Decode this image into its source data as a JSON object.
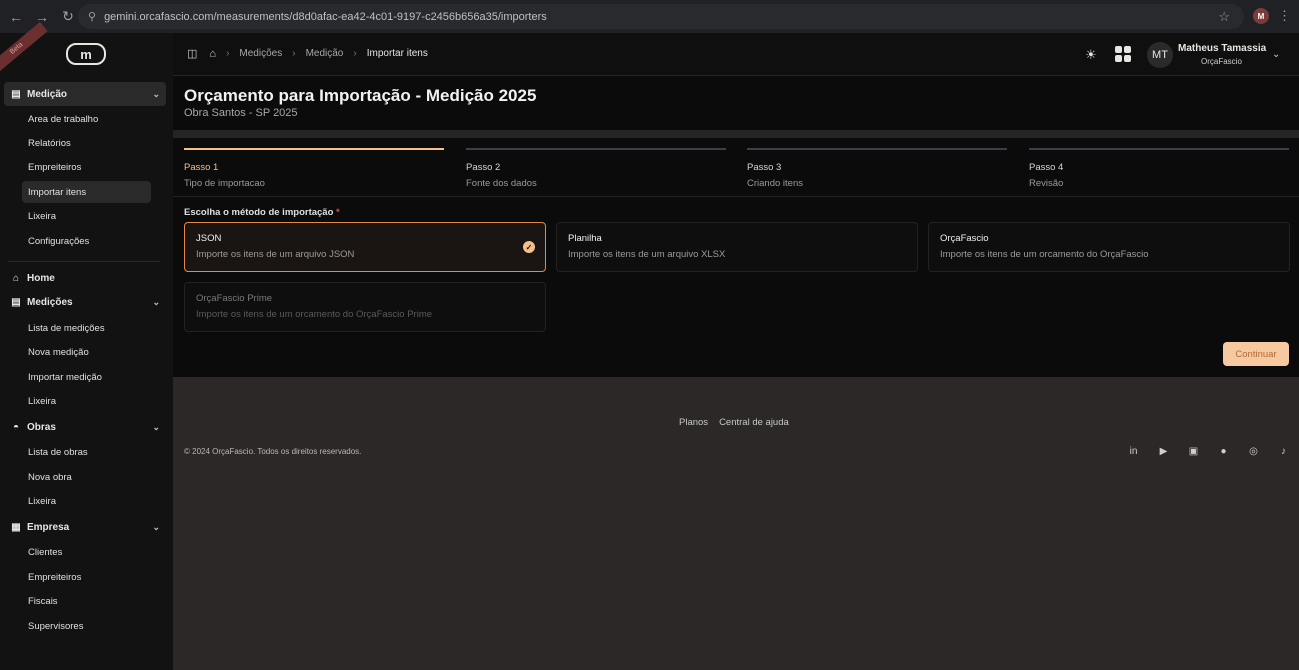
{
  "browser": {
    "url": "gemini.orcafascio.com/measurements/d8d0afac-ea42-4c01-9197-c2456b656a35/importers",
    "profile_initial": "M"
  },
  "sidebar": {
    "beta_label": "Beta",
    "logo_text": "m",
    "groups": [
      {
        "label": "Medição",
        "items": [
          "Area de trabalho",
          "Relatórios",
          "Empreiteiros",
          "Importar itens",
          "Lixeira",
          "Configurações"
        ]
      }
    ],
    "home_label": "Home",
    "medicoes": {
      "label": "Medições",
      "items": [
        "Lista de medições",
        "Nova medição",
        "Importar medição",
        "Lixeira"
      ]
    },
    "obras": {
      "label": "Obras",
      "items": [
        "Lista de obras",
        "Nova obra",
        "Lixeira"
      ]
    },
    "empresa": {
      "label": "Empresa",
      "items": [
        "Clientes",
        "Empreiteiros",
        "Fiscais",
        "Supervisores"
      ]
    }
  },
  "topbar": {
    "breadcrumb": [
      "Medições",
      "Medição",
      "Importar itens"
    ],
    "user": {
      "initials": "MT",
      "name": "Matheus Tamassia",
      "org": "OrçaFascio"
    }
  },
  "page": {
    "title": "Orçamento para Importação - Medição 2025",
    "subtitle": "Obra Santos - SP 2025"
  },
  "steps": [
    {
      "num": "Passo 1",
      "desc": "Tipo de importacao",
      "active": true
    },
    {
      "num": "Passo 2",
      "desc": "Fonte dos dados",
      "active": false
    },
    {
      "num": "Passo 3",
      "desc": "Criando itens",
      "active": false
    },
    {
      "num": "Passo 4",
      "desc": "Revisão",
      "active": false
    }
  ],
  "method": {
    "label": "Escolha o método de importação",
    "required_mark": "*",
    "options": [
      {
        "title": "JSON",
        "desc": "Importe os itens de um arquivo JSON",
        "selected": true
      },
      {
        "title": "Planilha",
        "desc": "Importe os itens de um arquivo XLSX"
      },
      {
        "title": "OrçaFascio",
        "desc": "Importe os itens de um orcamento do OrçaFascio"
      },
      {
        "title": "OrçaFascio Prime",
        "desc": "Importe os itens de um orcamento do OrçaFascio Prime",
        "disabled": true
      }
    ]
  },
  "actions": {
    "continue_label": "Continuar"
  },
  "footer": {
    "links": [
      "Planos",
      "Central de ajuda"
    ],
    "copyright": "© 2024 OrçaFascio. Todos os direitos reservados.",
    "socials": [
      "linkedin-icon",
      "play-icon",
      "youtube-icon",
      "facebook-icon",
      "instagram-icon",
      "tiktok-icon"
    ]
  },
  "colors": {
    "accent": "#f3c08a",
    "selected_border": "#e5894b",
    "button_bg": "#f6c9a0"
  }
}
